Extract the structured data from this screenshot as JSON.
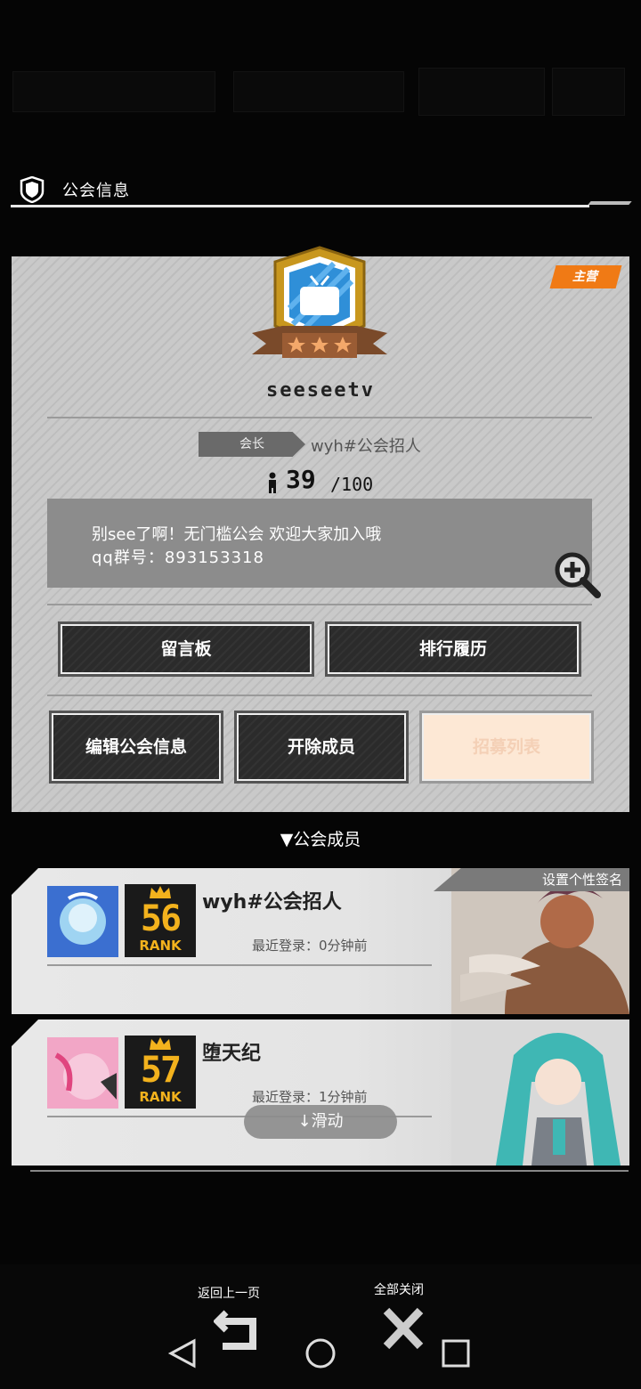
{
  "header": {
    "title": "公会信息"
  },
  "guild": {
    "tag": "主营",
    "name": "seeseetv",
    "leader_label": "会长",
    "leader_name": "wyh#公会招人",
    "member_count": "39",
    "member_max": "/100",
    "notice_line1": "别see了啊！无门槛公会 欢迎大家加入哦",
    "notice_line2": "qq群号：893153318",
    "stars": 3
  },
  "buttons": {
    "message_board": "留言板",
    "ranking_history": "排行履历",
    "edit_guild": "编辑公会信息",
    "remove_member": "开除成员",
    "recruit_list": "招募列表"
  },
  "members_section": {
    "title": "▼公会成员"
  },
  "members": [
    {
      "name": "wyh#公会招人",
      "rank": "56",
      "rank_label": "RANK",
      "last_login": "最近登录：0分钟前",
      "signature_tag": "设置个性签名"
    },
    {
      "name": "堕天纪",
      "rank": "57",
      "rank_label": "RANK",
      "last_login": "最近登录：1分钟前"
    }
  ],
  "scroll_hint": "↓滑动",
  "bottom_controls": {
    "back_label": "返回上一页",
    "close_all_label": "全部关闭"
  },
  "colors": {
    "accent_orange": "#f07a15",
    "rank_gold": "#f3b21d",
    "emblem_blue": "#2f8fd8"
  }
}
